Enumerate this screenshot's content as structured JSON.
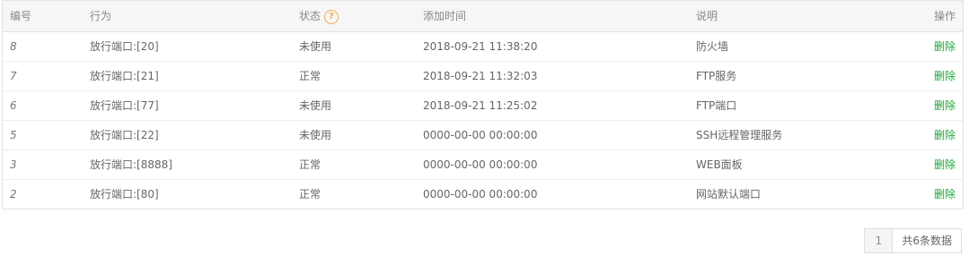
{
  "table": {
    "headers": {
      "num": "编号",
      "action": "行为",
      "status": "状态",
      "time": "添加时间",
      "desc": "说明",
      "op": "操作"
    },
    "help_icon_glyph": "?",
    "rows": [
      {
        "num": "8",
        "action": "放行端口:[20]",
        "status": "未使用",
        "time": "2018-09-21 11:38:20",
        "desc": "防火墙",
        "op": "删除"
      },
      {
        "num": "7",
        "action": "放行端口:[21]",
        "status": "正常",
        "time": "2018-09-21 11:32:03",
        "desc": "FTP服务",
        "op": "删除"
      },
      {
        "num": "6",
        "action": "放行端口:[77]",
        "status": "未使用",
        "time": "2018-09-21 11:25:02",
        "desc": "FTP端口",
        "op": "删除"
      },
      {
        "num": "5",
        "action": "放行端口:[22]",
        "status": "未使用",
        "time": "0000-00-00 00:00:00",
        "desc": "SSH远程管理服务",
        "op": "删除"
      },
      {
        "num": "3",
        "action": "放行端口:[8888]",
        "status": "正常",
        "time": "0000-00-00 00:00:00",
        "desc": "WEB面板",
        "op": "删除"
      },
      {
        "num": "2",
        "action": "放行端口:[80]",
        "status": "正常",
        "time": "0000-00-00 00:00:00",
        "desc": "网站默认端口",
        "op": "删除"
      }
    ]
  },
  "pager": {
    "current_page": "1",
    "total_text": "共6条数据"
  },
  "colors": {
    "accent_green": "#20a53a",
    "help_orange": "#f0ad4e"
  }
}
